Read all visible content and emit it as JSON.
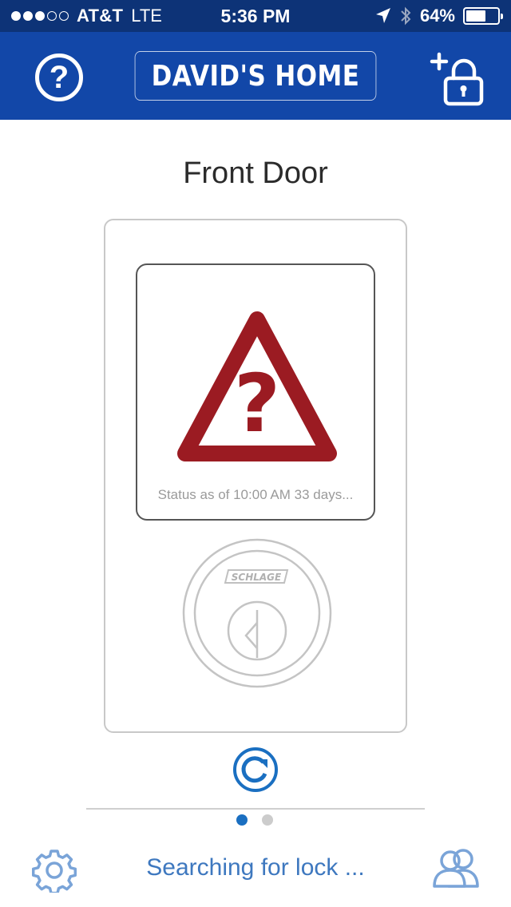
{
  "status_bar": {
    "carrier": "AT&T",
    "network": "LTE",
    "time": "5:36 PM",
    "battery": "64%",
    "battery_level": 0.64,
    "signal_strength": 3,
    "signal_max": 5
  },
  "header": {
    "home_name": "DAVID'S HOME",
    "help_icon": "help-circle-icon",
    "add_lock_icon": "add-lock-icon",
    "color": "#1247a8"
  },
  "lock": {
    "name": "Front Door",
    "status_text": "Status as of 10:00 AM 33 days...",
    "brand": "SCHLAGE",
    "status_icon": "warning-question-icon",
    "alert_color": "#9b1b22"
  },
  "footer": {
    "search_status": "Searching for lock ...",
    "page_count": 2,
    "active_page": 1,
    "accent_color": "#1a6fc1"
  }
}
